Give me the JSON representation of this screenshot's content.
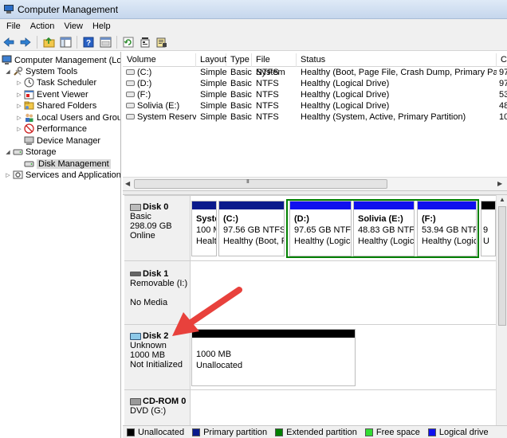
{
  "window": {
    "title": "Computer Management"
  },
  "menu": [
    "File",
    "Action",
    "View",
    "Help"
  ],
  "toolbar": [
    "back-icon",
    "forward-icon",
    "up-folder-icon",
    "show-hide-tree-icon",
    "help-icon",
    "console-icon",
    "refresh-icon",
    "properties-icon",
    "export-icon"
  ],
  "tree": {
    "root": "Computer Management (Local",
    "system_tools": "System Tools",
    "task_scheduler": "Task Scheduler",
    "event_viewer": "Event Viewer",
    "shared_folders": "Shared Folders",
    "local_users": "Local Users and Groups",
    "performance": "Performance",
    "device_manager": "Device Manager",
    "storage": "Storage",
    "disk_management": "Disk Management",
    "services": "Services and Applications"
  },
  "volume_list": {
    "columns": [
      "Volume",
      "Layout",
      "Type",
      "File System",
      "Status",
      "C"
    ],
    "rows": [
      {
        "volume": "(C:)",
        "layout": "Simple",
        "type": "Basic",
        "fs": "NTFS",
        "status": "Healthy (Boot, Page File, Crash Dump, Primary Partition)",
        "cap": "97"
      },
      {
        "volume": "(D:)",
        "layout": "Simple",
        "type": "Basic",
        "fs": "NTFS",
        "status": "Healthy (Logical Drive)",
        "cap": "97"
      },
      {
        "volume": "(F:)",
        "layout": "Simple",
        "type": "Basic",
        "fs": "NTFS",
        "status": "Healthy (Logical Drive)",
        "cap": "53"
      },
      {
        "volume": "Solivia (E:)",
        "layout": "Simple",
        "type": "Basic",
        "fs": "NTFS",
        "status": "Healthy (Logical Drive)",
        "cap": "48"
      },
      {
        "volume": "System Reserved",
        "layout": "Simple",
        "type": "Basic",
        "fs": "NTFS",
        "status": "Healthy (System, Active, Primary Partition)",
        "cap": "10"
      }
    ],
    "scroll_grip": "III"
  },
  "disks": {
    "disk0": {
      "name": "Disk 0",
      "type": "Basic",
      "size": "298.09 GB",
      "status": "Online",
      "partitions": {
        "sys": {
          "name": "Syste",
          "size": "100 M",
          "status": "Healt"
        },
        "c": {
          "name": "(C:)",
          "size": "97.56 GB NTFS",
          "status": "Healthy (Boot, Pa"
        },
        "d": {
          "name": "(D:)",
          "size": "97.65 GB NTFS",
          "status": "Healthy (Logica"
        },
        "e": {
          "name": "Solivia  (E:)",
          "size": "48.83 GB NTFS",
          "status": "Healthy (Logica"
        },
        "f": {
          "name": "(F:)",
          "size": "53.94 GB NTFS",
          "status": "Healthy (Logica"
        },
        "free": {
          "size": "9",
          "status": "U"
        }
      }
    },
    "disk1": {
      "name": "Disk 1",
      "type": "Removable (I:)",
      "media": "No Media"
    },
    "disk2": {
      "name": "Disk 2",
      "type": "Unknown",
      "size": "1000 MB",
      "status": "Not Initialized",
      "partition": {
        "size": "1000 MB",
        "status": "Unallocated"
      }
    },
    "cdrom0": {
      "name": "CD-ROM 0",
      "type": "DVD (G:)"
    }
  },
  "legend": [
    {
      "label": "Unallocated",
      "color": "#000000"
    },
    {
      "label": "Primary partition",
      "color": "#0a1a8c"
    },
    {
      "label": "Extended partition",
      "color": "#008000"
    },
    {
      "label": "Free space",
      "color": "#33dd33"
    },
    {
      "label": "Logical drive",
      "color": "#1010ee"
    }
  ],
  "colors": {
    "primary_bar": "#0a1a8c",
    "logical_bar": "#1010ee",
    "unallocated_bar": "#000000",
    "extended_frame": "#008000",
    "annotation_arrow": "#e8413c"
  }
}
